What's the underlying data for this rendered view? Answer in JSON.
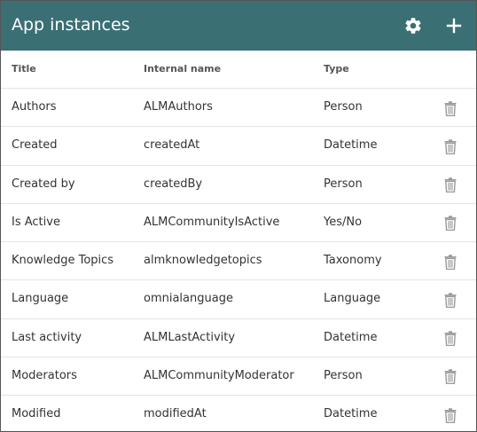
{
  "header": {
    "title": "App instances",
    "settings_icon": "gear-icon",
    "add_icon": "plus-icon",
    "background_color": "#3a6f74"
  },
  "columns": {
    "title": "Title",
    "internal_name": "Internal name",
    "type": "Type"
  },
  "rows": [
    {
      "title": "Authors",
      "internal_name": "ALMAuthors",
      "type": "Person"
    },
    {
      "title": "Created",
      "internal_name": "createdAt",
      "type": "Datetime"
    },
    {
      "title": "Created by",
      "internal_name": "createdBy",
      "type": "Person"
    },
    {
      "title": "Is Active",
      "internal_name": "ALMCommunityIsActive",
      "type": "Yes/No"
    },
    {
      "title": "Knowledge Topics",
      "internal_name": "almknowledgetopics",
      "type": "Taxonomy"
    },
    {
      "title": "Language",
      "internal_name": "omnialanguage",
      "type": "Language"
    },
    {
      "title": "Last activity",
      "internal_name": "ALMLastActivity",
      "type": "Datetime"
    },
    {
      "title": "Moderators",
      "internal_name": "ALMCommunityModerator",
      "type": "Person"
    },
    {
      "title": "Modified",
      "internal_name": "modifiedAt",
      "type": "Datetime"
    }
  ],
  "row_action_icon": "trash-icon"
}
